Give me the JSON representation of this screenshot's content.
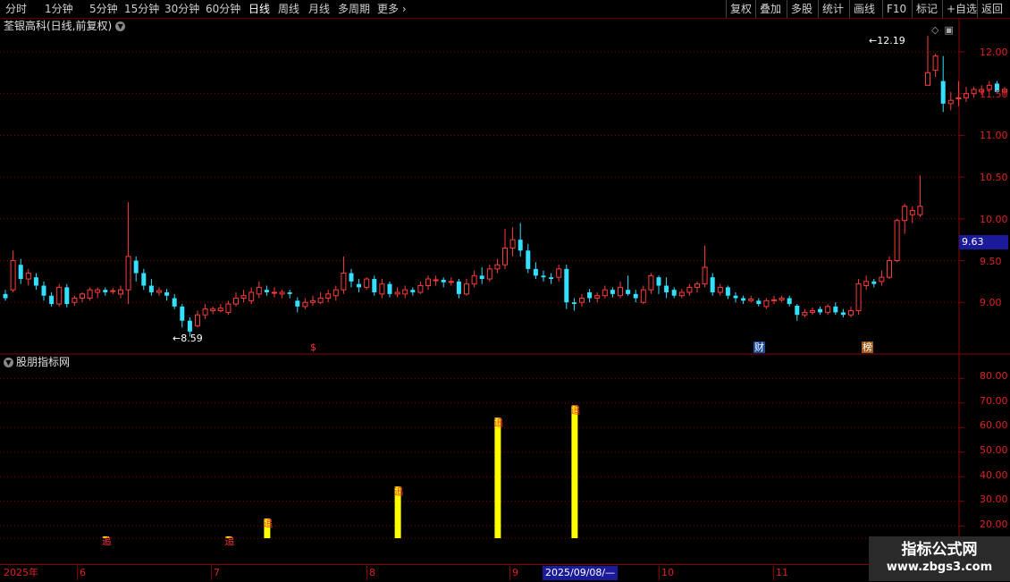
{
  "toolbar": {
    "periods": [
      "分时",
      "1分钟",
      "5分钟",
      "15分钟",
      "30分钟",
      "60分钟",
      "日线",
      "周线",
      "月线",
      "多周期",
      "更多"
    ],
    "active_period": "日线",
    "more_icon": "chevron-right-icon",
    "right_buttons": [
      "复权",
      "叠加",
      "多股",
      "统计",
      "画线",
      "F10",
      "标记",
      "+自选",
      "返回"
    ]
  },
  "stock": {
    "title": "荃银高科(日线,前复权)",
    "current_price_tag": "9.63",
    "high_label": "12.19",
    "low_label": "8.59"
  },
  "price_axis": [
    "12.00",
    "11.50",
    "11.00",
    "10.50",
    "10.00",
    "9.50",
    "9.00"
  ],
  "indicator": {
    "title": "股朋指标网",
    "axis": [
      "80.00",
      "70.00",
      "60.00",
      "50.00",
      "40.00",
      "30.00",
      "20.00"
    ],
    "signal_label": "追"
  },
  "date_axis": {
    "year": "2025年",
    "months": [
      "6",
      "7",
      "8",
      "9",
      "10",
      "11"
    ],
    "selected_date": "2025/09/08/—"
  },
  "markers": {
    "dollar": "$",
    "cai": "财",
    "bang": "榜"
  },
  "watermark": {
    "line1": "指标公式网",
    "line2": "www.zbgs3.com"
  },
  "colors": {
    "up": "#ff3b3b",
    "down": "#33e0ff",
    "bar": "#ffff00",
    "grid": "#8a0000"
  },
  "chart_data": [
    {
      "type": "candlestick",
      "price_range": [
        8.5,
        12.3
      ],
      "candles": [
        [
          9.1,
          9.05,
          9.15,
          9.02
        ],
        [
          9.15,
          9.5,
          9.62,
          9.12
        ],
        [
          9.45,
          9.28,
          9.52,
          9.22
        ],
        [
          9.28,
          9.35,
          9.4,
          9.2
        ],
        [
          9.3,
          9.2,
          9.35,
          9.15
        ],
        [
          9.2,
          9.08,
          9.25,
          9.02
        ],
        [
          9.08,
          8.98,
          9.12,
          8.95
        ],
        [
          8.98,
          9.18,
          9.22,
          8.95
        ],
        [
          9.18,
          8.98,
          9.22,
          8.94
        ],
        [
          9.0,
          9.05,
          9.08,
          8.96
        ],
        [
          9.05,
          9.1,
          9.12,
          9.0
        ],
        [
          9.05,
          9.15,
          9.18,
          9.02
        ],
        [
          9.12,
          9.15,
          9.18,
          9.05
        ],
        [
          9.15,
          9.12,
          9.18,
          9.08
        ],
        [
          9.13,
          9.14,
          9.17,
          9.1
        ],
        [
          9.1,
          9.15,
          9.2,
          9.05
        ],
        [
          9.15,
          9.55,
          10.2,
          8.98
        ],
        [
          9.5,
          9.35,
          9.55,
          9.25
        ],
        [
          9.35,
          9.2,
          9.4,
          9.15
        ],
        [
          9.2,
          9.12,
          9.28,
          9.08
        ],
        [
          9.12,
          9.14,
          9.18,
          9.08
        ],
        [
          9.12,
          9.08,
          9.16,
          9.02
        ],
        [
          9.05,
          8.95,
          9.1,
          8.92
        ],
        [
          8.95,
          8.78,
          8.98,
          8.7
        ],
        [
          8.78,
          8.65,
          8.82,
          8.59
        ],
        [
          8.72,
          8.85,
          8.9,
          8.7
        ],
        [
          8.85,
          8.92,
          8.98,
          8.8
        ],
        [
          8.9,
          8.92,
          8.95,
          8.86
        ],
        [
          8.9,
          8.93,
          8.98,
          8.88
        ],
        [
          8.88,
          8.98,
          9.02,
          8.85
        ],
        [
          8.98,
          9.05,
          9.12,
          8.95
        ],
        [
          9.05,
          9.08,
          9.15,
          9.0
        ],
        [
          9.02,
          9.12,
          9.18,
          8.98
        ],
        [
          9.1,
          9.18,
          9.25,
          9.05
        ],
        [
          9.15,
          9.12,
          9.2,
          9.08
        ],
        [
          9.12,
          9.12,
          9.18,
          9.06
        ],
        [
          9.1,
          9.12,
          9.15,
          9.05
        ],
        [
          9.12,
          9.1,
          9.15,
          9.05
        ],
        [
          9.02,
          8.95,
          9.06,
          8.88
        ],
        [
          8.95,
          9.0,
          9.05,
          8.92
        ],
        [
          9.0,
          9.02,
          9.08,
          8.96
        ],
        [
          9.0,
          9.05,
          9.12,
          8.98
        ],
        [
          9.05,
          9.1,
          9.15,
          9.0
        ],
        [
          9.08,
          9.15,
          9.2,
          9.02
        ],
        [
          9.15,
          9.35,
          9.55,
          9.1
        ],
        [
          9.35,
          9.25,
          9.4,
          9.18
        ],
        [
          9.22,
          9.18,
          9.28,
          9.12
        ],
        [
          9.18,
          9.28,
          9.3,
          9.15
        ],
        [
          9.28,
          9.12,
          9.32,
          9.08
        ],
        [
          9.1,
          9.22,
          9.28,
          9.05
        ],
        [
          9.22,
          9.1,
          9.25,
          9.06
        ],
        [
          9.1,
          9.12,
          9.18,
          9.06
        ],
        [
          9.1,
          9.15,
          9.2,
          9.05
        ],
        [
          9.15,
          9.12,
          9.18,
          9.08
        ],
        [
          9.12,
          9.2,
          9.25,
          9.1
        ],
        [
          9.2,
          9.28,
          9.32,
          9.15
        ],
        [
          9.26,
          9.27,
          9.32,
          9.2
        ],
        [
          9.27,
          9.24,
          9.3,
          9.18
        ],
        [
          9.24,
          9.25,
          9.3,
          9.2
        ],
        [
          9.25,
          9.1,
          9.28,
          9.05
        ],
        [
          9.1,
          9.22,
          9.28,
          9.08
        ],
        [
          9.22,
          9.32,
          9.38,
          9.18
        ],
        [
          9.32,
          9.28,
          9.42,
          9.22
        ],
        [
          9.28,
          9.4,
          9.45,
          9.25
        ],
        [
          9.4,
          9.45,
          9.52,
          9.35
        ],
        [
          9.45,
          9.65,
          9.88,
          9.4
        ],
        [
          9.65,
          9.75,
          9.9,
          9.55
        ],
        [
          9.75,
          9.62,
          9.95,
          9.55
        ],
        [
          9.62,
          9.4,
          9.7,
          9.35
        ],
        [
          9.4,
          9.32,
          9.48,
          9.28
        ],
        [
          9.32,
          9.3,
          9.38,
          9.25
        ],
        [
          9.3,
          9.28,
          9.35,
          9.22
        ],
        [
          9.3,
          9.4,
          9.45,
          9.25
        ],
        [
          9.4,
          9.0,
          9.45,
          8.92
        ],
        [
          9.0,
          8.98,
          9.05,
          8.9
        ],
        [
          9.0,
          9.05,
          9.1,
          8.95
        ],
        [
          9.12,
          9.05,
          9.16,
          9.0
        ],
        [
          9.05,
          9.08,
          9.12,
          9.0
        ],
        [
          9.08,
          9.15,
          9.2,
          9.05
        ],
        [
          9.15,
          9.1,
          9.18,
          9.06
        ],
        [
          9.08,
          9.18,
          9.25,
          9.05
        ],
        [
          9.15,
          9.1,
          9.32,
          9.08
        ],
        [
          9.1,
          9.05,
          9.15,
          9.0
        ],
        [
          9.0,
          9.15,
          9.2,
          8.98
        ],
        [
          9.15,
          9.32,
          9.35,
          9.1
        ],
        [
          9.3,
          9.2,
          9.32,
          9.1
        ],
        [
          9.2,
          9.12,
          9.3,
          9.05
        ],
        [
          9.15,
          9.08,
          9.18,
          9.05
        ],
        [
          9.08,
          9.12,
          9.16,
          9.05
        ],
        [
          9.12,
          9.18,
          9.22,
          9.08
        ],
        [
          9.18,
          9.22,
          9.25,
          9.12
        ],
        [
          9.22,
          9.42,
          9.68,
          9.18
        ],
        [
          9.3,
          9.12,
          9.35,
          9.08
        ],
        [
          9.12,
          9.18,
          9.22,
          9.08
        ],
        [
          9.18,
          9.08,
          9.2,
          9.04
        ],
        [
          9.08,
          9.05,
          9.12,
          9.0
        ],
        [
          9.05,
          9.02,
          9.08,
          8.98
        ],
        [
          9.02,
          9.04,
          9.08,
          9.0
        ],
        [
          9.02,
          8.98,
          9.05,
          8.95
        ],
        [
          8.95,
          9.02,
          9.05,
          8.92
        ],
        [
          9.02,
          9.03,
          9.08,
          8.98
        ],
        [
          9.03,
          9.05,
          9.08,
          9.0
        ],
        [
          9.05,
          8.98,
          9.08,
          8.95
        ],
        [
          8.96,
          8.85,
          8.98,
          8.78
        ],
        [
          8.85,
          8.88,
          8.92,
          8.82
        ],
        [
          8.88,
          8.9,
          8.94,
          8.85
        ],
        [
          8.92,
          8.88,
          8.95,
          8.85
        ],
        [
          8.88,
          8.95,
          8.98,
          8.85
        ],
        [
          8.95,
          8.88,
          9.0,
          8.85
        ],
        [
          8.88,
          8.85,
          8.92,
          8.82
        ],
        [
          8.85,
          8.9,
          8.95,
          8.82
        ],
        [
          8.9,
          9.22,
          9.28,
          8.85
        ],
        [
          9.2,
          9.25,
          9.32,
          9.15
        ],
        [
          9.25,
          9.22,
          9.28,
          9.18
        ],
        [
          9.25,
          9.3,
          9.38,
          9.2
        ],
        [
          9.3,
          9.5,
          9.55,
          9.28
        ],
        [
          9.5,
          9.98,
          10.0,
          9.48
        ],
        [
          9.98,
          10.15,
          10.18,
          9.82
        ],
        [
          10.05,
          10.1,
          10.15,
          9.95
        ],
        [
          10.05,
          10.15,
          10.52,
          10.02
        ],
        [
          11.6,
          11.75,
          12.19,
          11.6
        ],
        [
          11.78,
          11.95,
          11.98,
          11.7
        ],
        [
          11.65,
          11.38,
          11.95,
          11.28
        ],
        [
          11.38,
          11.42,
          11.52,
          11.3
        ],
        [
          11.45,
          11.45,
          11.65,
          11.35
        ],
        [
          11.45,
          11.5,
          11.58,
          11.4
        ],
        [
          11.5,
          11.55,
          11.58,
          11.45
        ],
        [
          11.52,
          11.55,
          11.6,
          11.48
        ],
        [
          11.55,
          11.6,
          11.65,
          11.52
        ],
        [
          11.62,
          11.52,
          11.65,
          11.5
        ],
        [
          11.52,
          11.55,
          11.58,
          11.48
        ]
      ]
    },
    {
      "type": "bar",
      "y_range": [
        10,
        85
      ],
      "bars": [
        {
          "index": 13,
          "value": 15,
          "label": "追"
        },
        {
          "index": 29,
          "value": 15,
          "label": "追"
        },
        {
          "index": 34,
          "value": 23,
          "label": "追"
        },
        {
          "index": 51,
          "value": 36,
          "label": "追"
        },
        {
          "index": 64,
          "value": 64,
          "label": "追"
        },
        {
          "index": 74,
          "value": 69,
          "label": "追"
        }
      ]
    }
  ]
}
